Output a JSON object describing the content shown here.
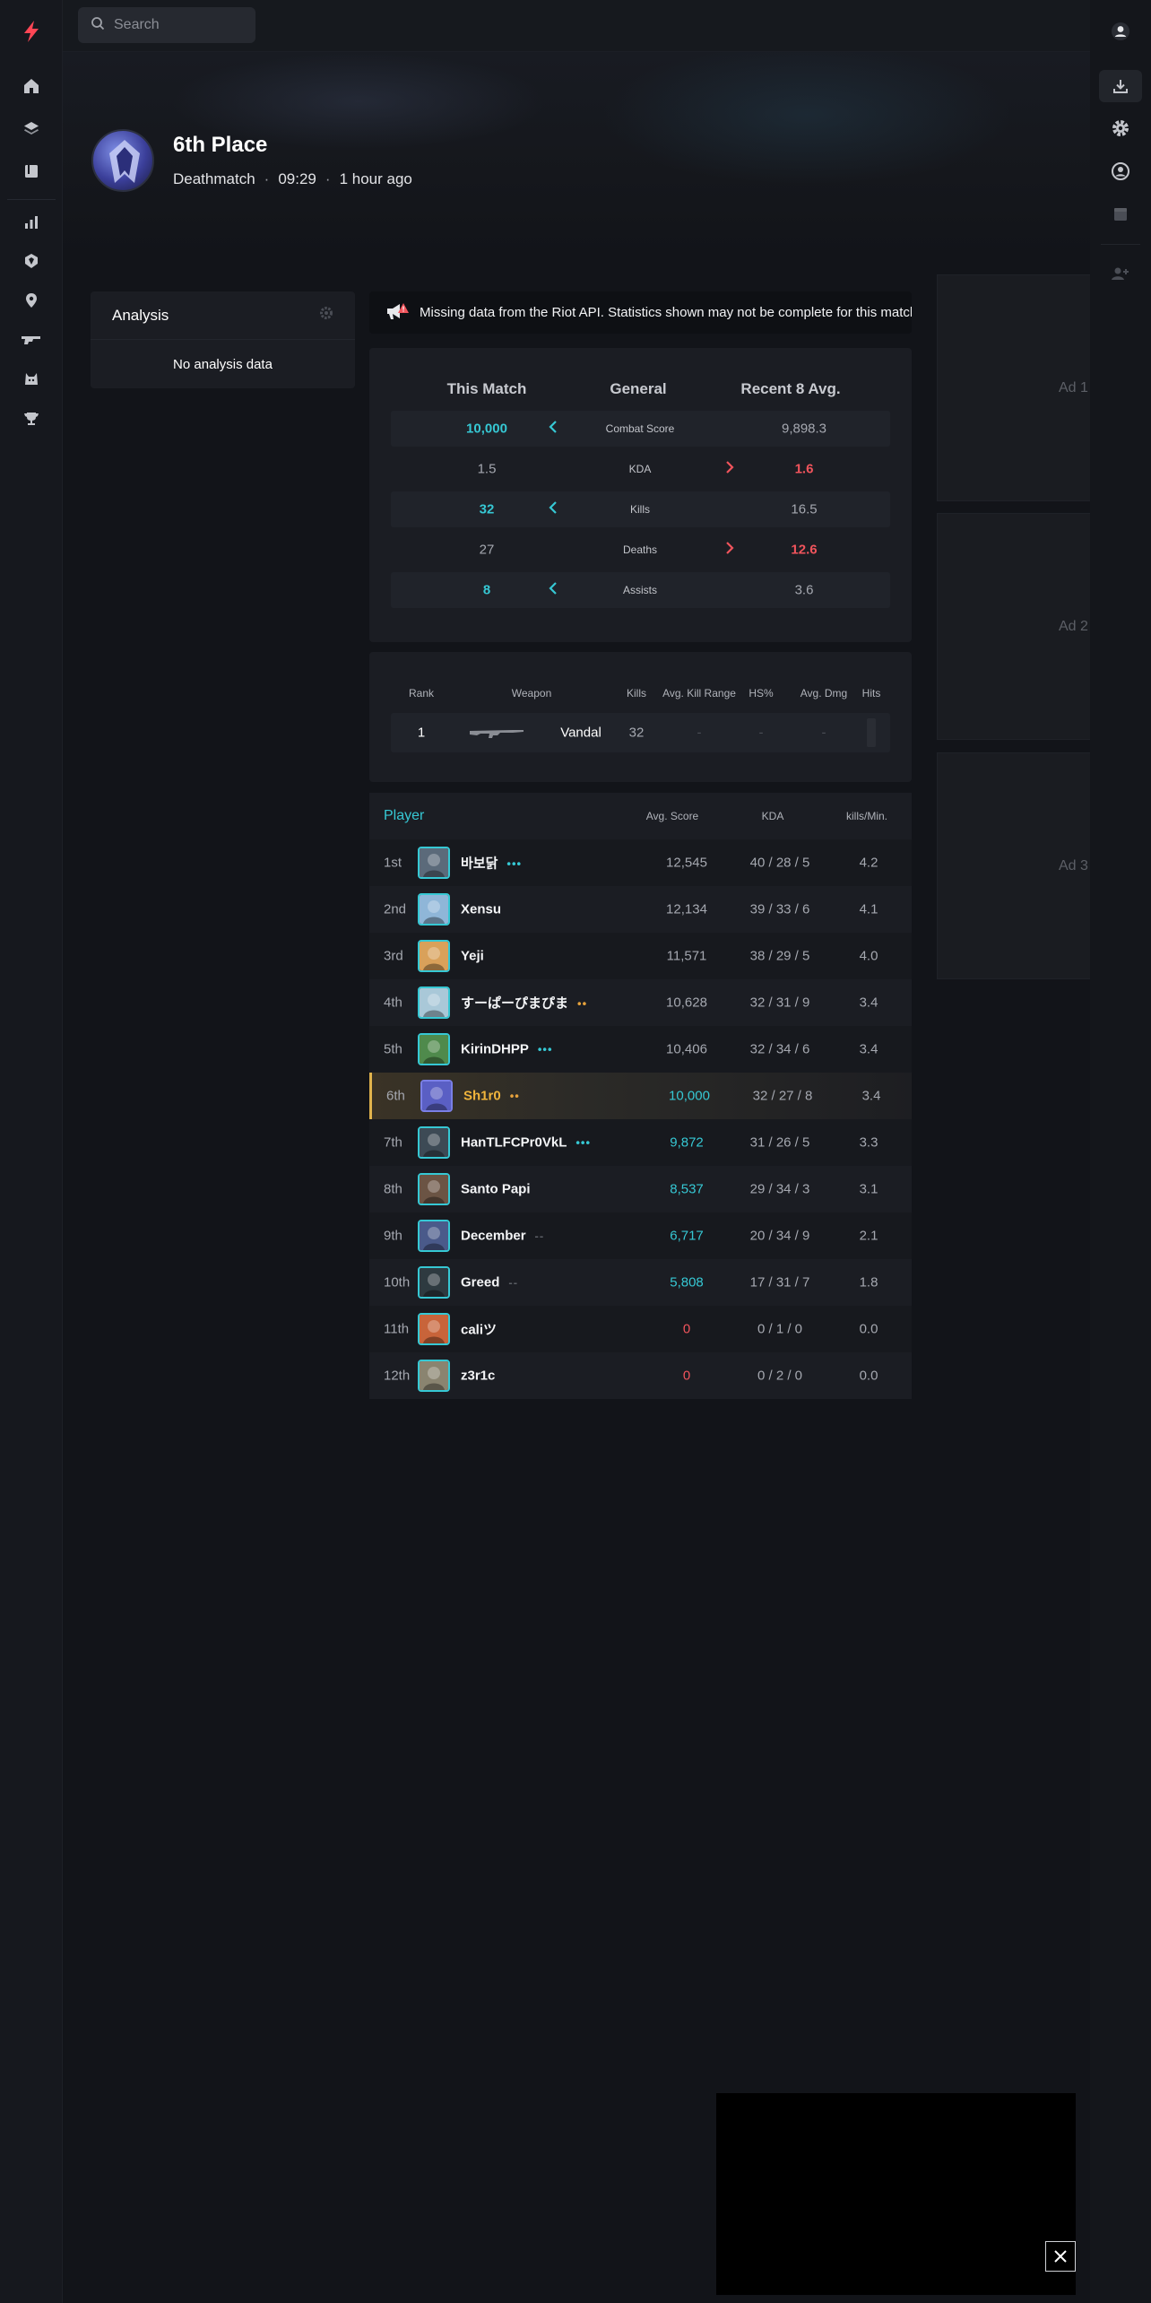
{
  "search": {
    "placeholder": "Search"
  },
  "match": {
    "place": "6th Place",
    "mode": "Deathmatch",
    "duration": "09:29",
    "time_ago": "1 hour ago",
    "separator": "·"
  },
  "analysis": {
    "title": "Analysis",
    "empty": "No analysis data"
  },
  "notice": {
    "text": "Missing data from the Riot API. Statistics shown may not be complete for this match."
  },
  "comparison": {
    "headers": [
      "This Match",
      "General",
      "Recent 8 Avg."
    ],
    "rows": [
      {
        "match": "10,000",
        "label": "Combat Score",
        "avg": "9,898.3",
        "better": "match"
      },
      {
        "match": "1.5",
        "label": "KDA",
        "avg": "1.6",
        "better": "avg"
      },
      {
        "match": "32",
        "label": "Kills",
        "avg": "16.5",
        "better": "match"
      },
      {
        "match": "27",
        "label": "Deaths",
        "avg": "12.6",
        "better": "avg"
      },
      {
        "match": "8",
        "label": "Assists",
        "avg": "3.6",
        "better": "match"
      }
    ]
  },
  "weapons": {
    "headers": [
      "Rank",
      "Weapon",
      "Kills",
      "Avg. Kill Range",
      "HS%",
      "Avg. Dmg",
      "Hits"
    ],
    "rows": [
      {
        "rank": "1",
        "weapon": "Vandal",
        "kills": "32",
        "range": "-",
        "hs": "-",
        "dmg": "-"
      }
    ]
  },
  "players": {
    "headers": {
      "player": "Player",
      "score": "Avg. Score",
      "kda": "KDA",
      "kpm": "kills/Min."
    },
    "rows": [
      {
        "rank": "1st",
        "name": "바보닭",
        "dots": "•••",
        "dot_color": "#36c8d4",
        "score": "12,545",
        "kda": "40 / 28 / 5",
        "kpm": "4.2",
        "score_color": "plain",
        "avatar": "#5b6a7a"
      },
      {
        "rank": "2nd",
        "name": "Xensu",
        "dots": "",
        "dot_color": "",
        "score": "12,134",
        "kda": "39 / 33 / 6",
        "kpm": "4.1",
        "score_color": "plain",
        "avatar": "#8fb6d8"
      },
      {
        "rank": "3rd",
        "name": "Yeji",
        "dots": "",
        "dot_color": "",
        "score": "11,571",
        "kda": "38 / 29 / 5",
        "kpm": "4.0",
        "score_color": "plain",
        "avatar": "#d9a15a"
      },
      {
        "rank": "4th",
        "name": "すーぱーぴまぴま",
        "dots": "••",
        "dot_color": "#e6a23c",
        "score": "10,628",
        "kda": "32 / 31 / 9",
        "kpm": "3.4",
        "score_color": "plain",
        "avatar": "#a9c8d8"
      },
      {
        "rank": "5th",
        "name": "KirinDHPP",
        "dots": "•••",
        "dot_color": "#36c8d4",
        "score": "10,406",
        "kda": "32 / 34 / 6",
        "kpm": "3.4",
        "score_color": "plain",
        "avatar": "#4f8a4c"
      },
      {
        "rank": "6th",
        "name": "Sh1r0",
        "dots": "••",
        "dot_color": "#e6a23c",
        "score": "10,000",
        "kda": "32 / 27 / 8",
        "kpm": "3.4",
        "score_color": "teal",
        "avatar": "#5a5fc4",
        "me": true
      },
      {
        "rank": "7th",
        "name": "HanTLFCPr0VkL",
        "dots": "•••",
        "dot_color": "#36c8d4",
        "score": "9,872",
        "kda": "31 / 26 / 5",
        "kpm": "3.3",
        "score_color": "teal",
        "avatar": "#3d4a55"
      },
      {
        "rank": "8th",
        "name": "Santo Papi",
        "dots": "",
        "dot_color": "",
        "score": "8,537",
        "kda": "29 / 34 / 3",
        "kpm": "3.1",
        "score_color": "teal",
        "avatar": "#6b5444"
      },
      {
        "rank": "9th",
        "name": "December",
        "dots": "--",
        "dot_color": "#5a5d64",
        "score": "6,717",
        "kda": "20 / 34 / 9",
        "kpm": "2.1",
        "score_color": "teal",
        "avatar": "#4a5a8a"
      },
      {
        "rank": "10th",
        "name": "Greed",
        "dots": "--",
        "dot_color": "#5a5d64",
        "score": "5,808",
        "kda": "17 / 31 / 7",
        "kpm": "1.8",
        "score_color": "teal",
        "avatar": "#2e3a40"
      },
      {
        "rank": "11th",
        "name": "caliツ",
        "dots": "",
        "dot_color": "",
        "score": "0",
        "kda": "0 / 1 / 0",
        "kpm": "0.0",
        "score_color": "red",
        "avatar": "#c8643a"
      },
      {
        "rank": "12th",
        "name": "z3r1c",
        "dots": "",
        "dot_color": "",
        "score": "0",
        "kda": "0 / 2 / 0",
        "kpm": "0.0",
        "score_color": "red",
        "avatar": "#8a8470"
      }
    ]
  },
  "ads": [
    "Ad 1",
    "Ad 2",
    "Ad 3"
  ],
  "colors": {
    "accent": "#36c8d4",
    "negative": "#f0545c",
    "brand": "#ff4655",
    "highlight": "#e0b34c"
  },
  "icons": {
    "left_rail": [
      "logo-bolt-icon",
      "home-icon",
      "layers-icon",
      "book-icon",
      "chart-icon",
      "agent-icon",
      "map-pin-icon",
      "gun-icon",
      "cat-icon",
      "trophy-icon"
    ],
    "right_rail": [
      "user-icon",
      "download-icon",
      "gear-icon",
      "profile-icon",
      "box-icon",
      "add-friend-icon"
    ]
  }
}
